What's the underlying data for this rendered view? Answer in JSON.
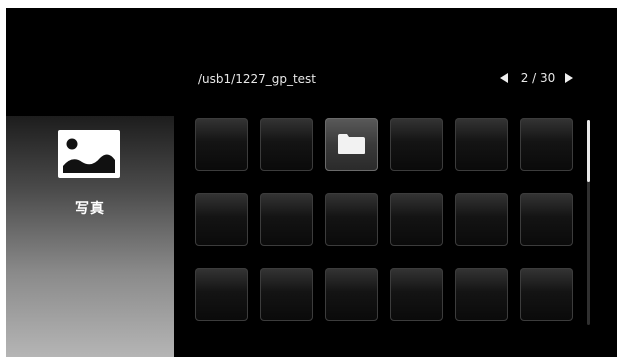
{
  "header": {
    "path": "/usb1/1227_gp_test",
    "pager": {
      "prev_icon": "triangle-left-icon",
      "page": "2 / 30",
      "next_icon": "triangle-right-icon"
    }
  },
  "sidebar": {
    "category_icon": "photo-icon",
    "category_label": "写真"
  },
  "grid": {
    "columns": 6,
    "rows": 3,
    "selected_index": 2,
    "tiles": [
      {
        "type": "empty"
      },
      {
        "type": "empty"
      },
      {
        "type": "folder",
        "icon": "folder-icon"
      },
      {
        "type": "empty"
      },
      {
        "type": "empty"
      },
      {
        "type": "empty"
      },
      {
        "type": "empty"
      },
      {
        "type": "empty"
      },
      {
        "type": "empty"
      },
      {
        "type": "empty"
      },
      {
        "type": "empty"
      },
      {
        "type": "empty"
      },
      {
        "type": "empty"
      },
      {
        "type": "empty"
      },
      {
        "type": "empty"
      },
      {
        "type": "empty"
      },
      {
        "type": "empty"
      },
      {
        "type": "empty"
      }
    ]
  },
  "scrollbar": {
    "thumb_position_fraction": 0.0,
    "visible_fraction": 0.3
  },
  "colors": {
    "background": "#000000",
    "text": "#e8e8e8",
    "sidebar_top": "#1d1d1d",
    "sidebar_bottom": "#b5b5b5",
    "selected_tile": "#4a4a4a"
  }
}
